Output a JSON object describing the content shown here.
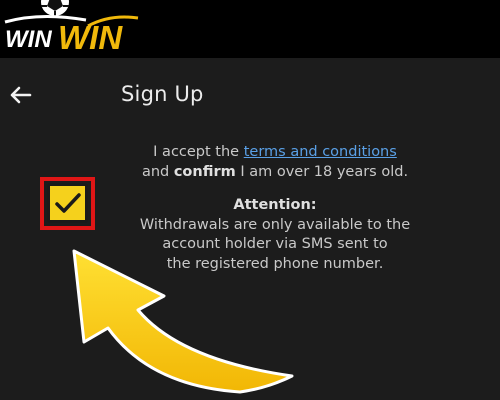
{
  "logo": {
    "part1": "WIN",
    "part2": "WIN",
    "icon": "soccer-ball-icon"
  },
  "header": {
    "back_icon": "arrow-left-icon",
    "title": "Sign Up"
  },
  "consent": {
    "checkbox_checked": true,
    "text_before_link": "I accept the ",
    "link_text": "terms and conditions",
    "text_and": "and ",
    "text_bold": "confirm",
    "text_after": " I am over 18 years old."
  },
  "attention": {
    "title": "Attention:",
    "line1": "Withdrawals are only available to the",
    "line2": "account holder via SMS sent to",
    "line3": "the registered phone number."
  },
  "colors": {
    "background": "#1c1c1c",
    "topbar": "#000000",
    "accent_yellow": "#f5d11c",
    "highlight_red": "#e01616",
    "link_blue": "#5aa0e6"
  }
}
